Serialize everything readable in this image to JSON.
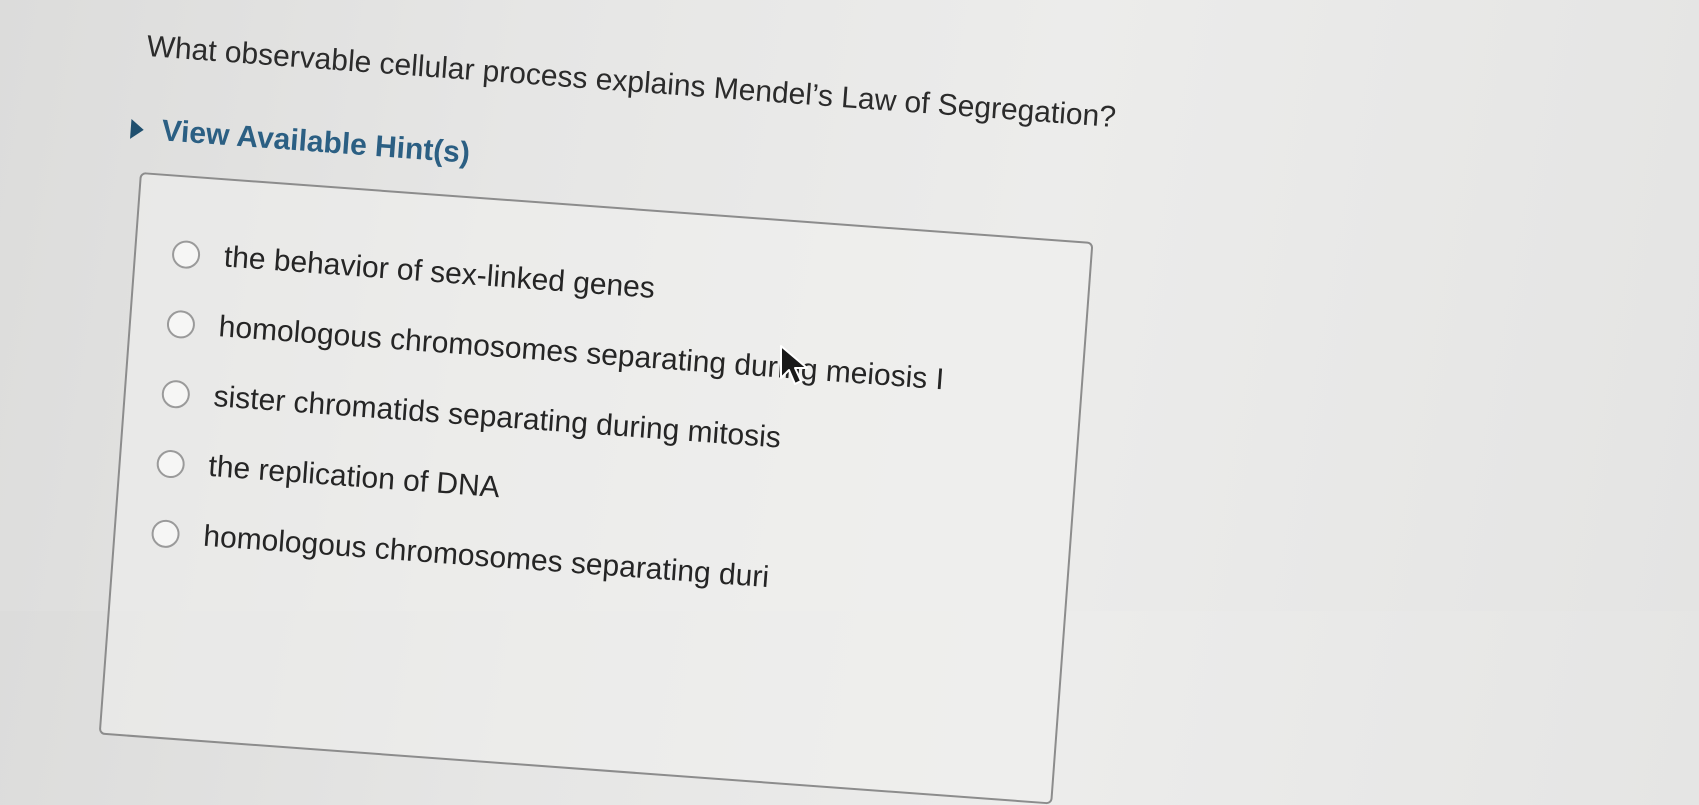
{
  "question": {
    "text": "What observable cellular process explains Mendel’s Law of Segregation?"
  },
  "hint": {
    "label": "View Available Hint(s)",
    "icon": "triangle-right-icon"
  },
  "options": [
    {
      "label": "the behavior of sex-linked genes"
    },
    {
      "label": "homologous chromosomes separating during meiosis I"
    },
    {
      "label": "sister chromatids separating during mitosis"
    },
    {
      "label": "the replication of DNA"
    },
    {
      "label": "homologous chromosomes separating duri"
    }
  ],
  "colors": {
    "hint_text": "#2b5f83",
    "hint_arrow": "#1f4f6e",
    "body_text": "#2b2b2b",
    "box_border": "#8c8c8c",
    "background": "#e6e6e5"
  }
}
